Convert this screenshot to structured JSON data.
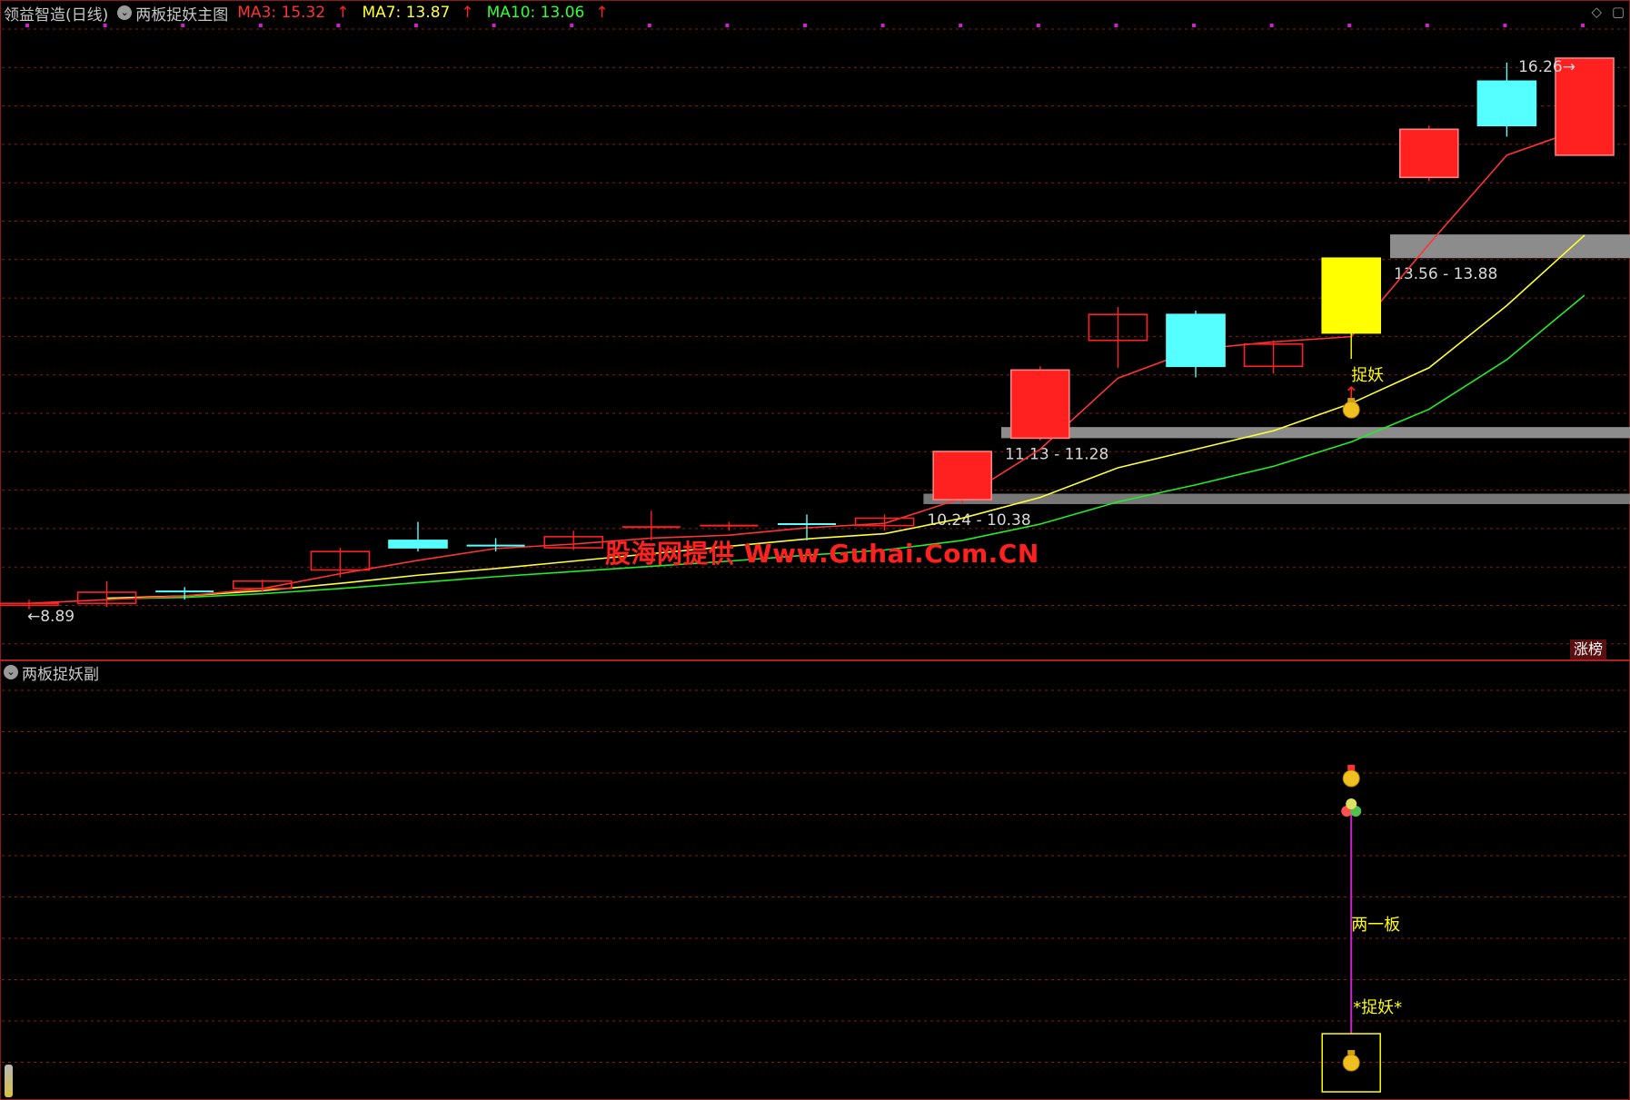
{
  "header": {
    "stock_title": "领益智造(日线)",
    "indicator_name": "两板捉妖主图",
    "ma3_label": "MA3: 15.32",
    "ma7_label": "MA7: 13.87",
    "ma10_label": "MA10: 13.06",
    "up_arrow": "↑"
  },
  "sub_header": {
    "indicator_name": "两板捉妖副"
  },
  "badge": {
    "label": "涨榜"
  },
  "watermark": "股海网提供 Www.Guhai.Com.CN",
  "icons": {
    "settings": "◇",
    "window": "▢",
    "chevron": "⌄"
  },
  "colors": {
    "up": "#ff2020",
    "down": "#55ffff",
    "signal": "#ffff00",
    "ma3": "#ff3333",
    "ma7": "#ffff33",
    "ma10": "#22ee22",
    "grid": "#8b1a1a",
    "zone": "#8c8c8c"
  },
  "chart_data": {
    "type": "candlestick",
    "ylim": [
      8.4,
      16.8
    ],
    "candles": [
      {
        "o": 8.88,
        "h": 8.95,
        "l": 8.82,
        "c": 8.9,
        "style": "up-hollow"
      },
      {
        "o": 8.9,
        "h": 9.2,
        "l": 8.85,
        "c": 9.05,
        "style": "up-hollow"
      },
      {
        "o": 9.08,
        "h": 9.12,
        "l": 8.95,
        "c": 9.06,
        "style": "doji"
      },
      {
        "o": 9.1,
        "h": 9.22,
        "l": 9.05,
        "c": 9.2,
        "style": "up-hollow"
      },
      {
        "o": 9.35,
        "h": 9.65,
        "l": 9.25,
        "c": 9.6,
        "style": "up-hollow"
      },
      {
        "o": 9.75,
        "h": 10.0,
        "l": 9.6,
        "c": 9.65,
        "style": "down"
      },
      {
        "o": 9.7,
        "h": 9.78,
        "l": 9.6,
        "c": 9.68,
        "style": "doji"
      },
      {
        "o": 9.65,
        "h": 9.88,
        "l": 9.62,
        "c": 9.8,
        "style": "up-hollow"
      },
      {
        "o": 9.9,
        "h": 10.15,
        "l": 9.75,
        "c": 9.93,
        "style": "doji-red"
      },
      {
        "o": 9.95,
        "h": 10.0,
        "l": 9.88,
        "c": 9.95,
        "style": "doji-red"
      },
      {
        "o": 9.95,
        "h": 10.1,
        "l": 9.75,
        "c": 9.97,
        "style": "doji"
      },
      {
        "o": 9.95,
        "h": 10.1,
        "l": 9.88,
        "c": 10.05,
        "style": "up-hollow"
      },
      {
        "o": 10.3,
        "h": 10.95,
        "l": 10.24,
        "c": 10.95,
        "style": "up-solid"
      },
      {
        "o": 11.13,
        "h": 12.1,
        "l": 11.1,
        "c": 12.05,
        "style": "up-solid"
      },
      {
        "o": 12.45,
        "h": 12.9,
        "l": 12.08,
        "c": 12.8,
        "style": "up-hollow"
      },
      {
        "o": 12.8,
        "h": 12.85,
        "l": 11.95,
        "c": 12.1,
        "style": "down"
      },
      {
        "o": 12.1,
        "h": 12.45,
        "l": 12.0,
        "c": 12.4,
        "style": "up-hollow"
      },
      {
        "o": 12.55,
        "h": 13.56,
        "l": 12.2,
        "c": 13.56,
        "style": "signal"
      },
      {
        "o": 14.65,
        "h": 15.35,
        "l": 14.6,
        "c": 15.3,
        "style": "up-solid"
      },
      {
        "o": 15.35,
        "h": 16.2,
        "l": 15.2,
        "c": 15.95,
        "style": "down"
      },
      {
        "o": 14.95,
        "h": 16.26,
        "l": 14.95,
        "c": 16.26,
        "style": "up-solid"
      }
    ],
    "ma3": [
      8.9,
      8.95,
      9.0,
      9.1,
      9.3,
      9.48,
      9.64,
      9.7,
      9.78,
      9.82,
      9.92,
      9.98,
      10.32,
      10.98,
      11.94,
      12.33,
      12.43,
      12.5,
      13.75,
      14.95,
      15.32
    ],
    "ma7": [
      null,
      8.97,
      9.0,
      9.07,
      9.17,
      9.28,
      9.37,
      9.47,
      9.57,
      9.67,
      9.77,
      9.84,
      10.05,
      10.33,
      10.73,
      10.98,
      11.23,
      11.6,
      12.08,
      12.92,
      13.87
    ],
    "ma10": [
      null,
      8.96,
      8.98,
      9.03,
      9.1,
      9.18,
      9.26,
      9.33,
      9.4,
      9.47,
      9.55,
      9.62,
      9.75,
      9.97,
      10.27,
      10.5,
      10.75,
      11.08,
      11.52,
      12.19,
      13.06
    ],
    "zones": [
      {
        "low": 10.24,
        "high": 10.38,
        "label": "10.24 - 10.38",
        "from_index": 11.5
      },
      {
        "low": 11.13,
        "high": 11.28,
        "label": "11.13 - 11.28",
        "from_index": 12.5
      },
      {
        "low": 13.56,
        "high": 13.88,
        "label": "13.56 - 13.88",
        "from_index": 17.5
      }
    ],
    "low_marker": {
      "index": 0,
      "value": 8.89,
      "label": "8.89",
      "arrow": "←"
    },
    "high_marker": {
      "index": 20,
      "value": 16.26,
      "label": "16.26",
      "arrow": "→"
    },
    "signal": {
      "index": 17,
      "label": "捉妖",
      "arrow": "↑",
      "bag_icon": "money-bag-icon"
    },
    "sub": {
      "signal_index": 17,
      "labels": [
        "两一板",
        "*捉妖*"
      ]
    }
  }
}
